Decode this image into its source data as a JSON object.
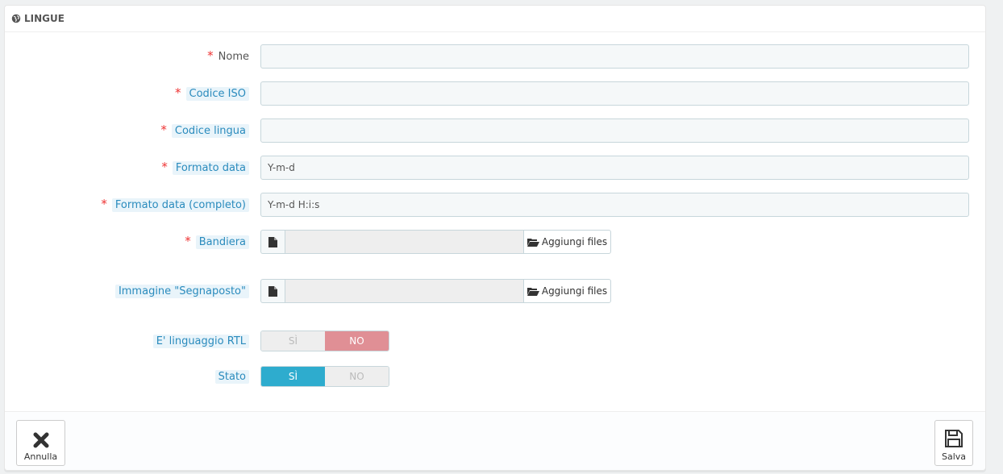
{
  "panel": {
    "title": "LINGUE",
    "title_icon": "globe-icon"
  },
  "fields": {
    "nome": {
      "label": "Nome",
      "value": "",
      "required": true
    },
    "codice_iso": {
      "label": "Codice ISO",
      "value": "",
      "required": true
    },
    "codice_lingua": {
      "label": "Codice lingua",
      "value": "",
      "required": true
    },
    "formato_data": {
      "label": "Formato data",
      "value": "Y-m-d",
      "required": true
    },
    "formato_data_completo": {
      "label": "Formato data (completo)",
      "value": "Y-m-d H:i:s",
      "required": true
    },
    "bandiera": {
      "label": "Bandiera",
      "button": "Aggiungi files",
      "required": true
    },
    "segnaposto": {
      "label": "Immagine \"Segnaposto\"",
      "button": "Aggiungi files"
    },
    "rtl": {
      "label": "E' linguaggio RTL",
      "yes": "SÌ",
      "no": "NO",
      "selected": "no"
    },
    "stato": {
      "label": "Stato",
      "yes": "SÌ",
      "no": "NO",
      "selected": "yes"
    }
  },
  "footer": {
    "cancel_label": "Annulla",
    "save_label": "Salva"
  },
  "colors": {
    "accent_yes": "#2eacce",
    "accent_no": "#e08f95",
    "hint_text": "#2a8bbd",
    "required": "#e33333"
  }
}
